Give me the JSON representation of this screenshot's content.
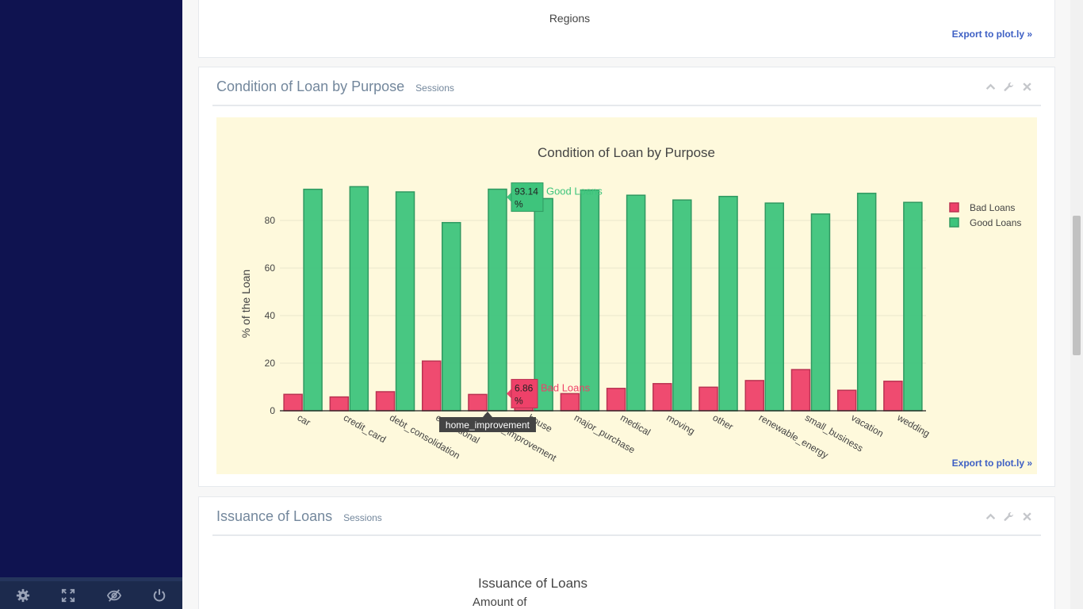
{
  "sidebar": {
    "footer_buttons": [
      {
        "icon": "gear-icon"
      },
      {
        "icon": "fullscreen-icon"
      },
      {
        "icon": "eye-slash-icon"
      },
      {
        "icon": "power-icon"
      }
    ]
  },
  "panels": {
    "regions": {
      "chart_label": "Regions",
      "export_label": "Export to plot.ly »"
    },
    "purpose": {
      "title": "Condition of Loan by Purpose",
      "subtitle": "Sessions",
      "export_label": "Export to plot.ly »"
    },
    "issuance": {
      "title": "Issuance of Loans",
      "subtitle": "Sessions",
      "chart_title": "Issuance of Loans",
      "chart_ylabel": "Amount of"
    }
  },
  "chart_data": {
    "type": "bar",
    "title": "Condition of Loan by Purpose",
    "xlabel": "",
    "ylabel": "% of the Loan",
    "ylim": [
      0,
      100
    ],
    "yticks": [
      0,
      20,
      40,
      60,
      80
    ],
    "categories": [
      "car",
      "credit_card",
      "debt_consolidation",
      "educational",
      "home_improvement",
      "house",
      "major_purchase",
      "medical",
      "moving",
      "other",
      "renewable_energy",
      "small_business",
      "vacation",
      "wedding"
    ],
    "series": [
      {
        "name": "Bad Loans",
        "color": "#ee4169",
        "values": [
          6.9,
          5.8,
          8.0,
          20.9,
          6.86,
          10.8,
          7.2,
          9.4,
          11.4,
          9.9,
          12.7,
          17.3,
          8.6,
          12.4
        ]
      },
      {
        "name": "Good Loans",
        "color": "#3ec47c",
        "values": [
          93.1,
          94.2,
          92.0,
          79.1,
          93.14,
          89.2,
          92.8,
          90.6,
          88.6,
          90.1,
          87.3,
          82.7,
          91.4,
          87.6
        ]
      }
    ],
    "legend_position": "top-right",
    "hover": {
      "category": "home_improvement",
      "labels": [
        {
          "value": "93.14",
          "unit": "%",
          "series": "Good Loans"
        },
        {
          "value": "6.86",
          "unit": "%",
          "series": "Bad Loans"
        }
      ]
    }
  }
}
